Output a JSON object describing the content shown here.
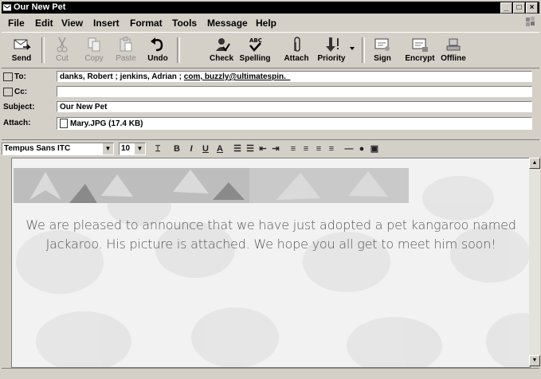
{
  "window": {
    "title": "Our New Pet"
  },
  "menu": [
    "File",
    "Edit",
    "View",
    "Insert",
    "Format",
    "Tools",
    "Message",
    "Help"
  ],
  "toolbar": [
    {
      "label": "Send",
      "icon": "send-icon",
      "enabled": true
    },
    {
      "label": "Cut",
      "icon": "cut-icon",
      "enabled": false
    },
    {
      "label": "Copy",
      "icon": "copy-icon",
      "enabled": false
    },
    {
      "label": "Paste",
      "icon": "paste-icon",
      "enabled": false
    },
    {
      "label": "Undo",
      "icon": "undo-icon",
      "enabled": true
    },
    {
      "label": "Check",
      "icon": "check-icon",
      "enabled": true
    },
    {
      "label": "Spelling",
      "icon": "spelling-icon",
      "enabled": true
    },
    {
      "label": "Attach",
      "icon": "paperclip-icon",
      "enabled": true
    },
    {
      "label": "Priority",
      "icon": "priority-icon",
      "enabled": true
    },
    {
      "label": "Sign",
      "icon": "sign-icon",
      "enabled": true
    },
    {
      "label": "Encrypt",
      "icon": "encrypt-icon",
      "enabled": true
    },
    {
      "label": "Offline",
      "icon": "offline-icon",
      "enabled": true
    }
  ],
  "header": {
    "to_label": "To:",
    "to_value_plain": "danks, Robert ; jenkins, Adrian ; ",
    "to_value_link": "com, buzzly@ultimatespin._",
    "cc_label": "Cc:",
    "cc_value": "",
    "subject_label": "Subject:",
    "subject_value": "Our New Pet",
    "attach_label": "Attach:",
    "attach_value": "Mary.JPG (17.4 KB)"
  },
  "format": {
    "font": "Tempus Sans ITC",
    "size": "10"
  },
  "body": {
    "message": "We are pleased to announce that we have just adopted a pet kangaroo named Jackaroo. His picture is attached. We hope you all get to meet him soon!"
  }
}
